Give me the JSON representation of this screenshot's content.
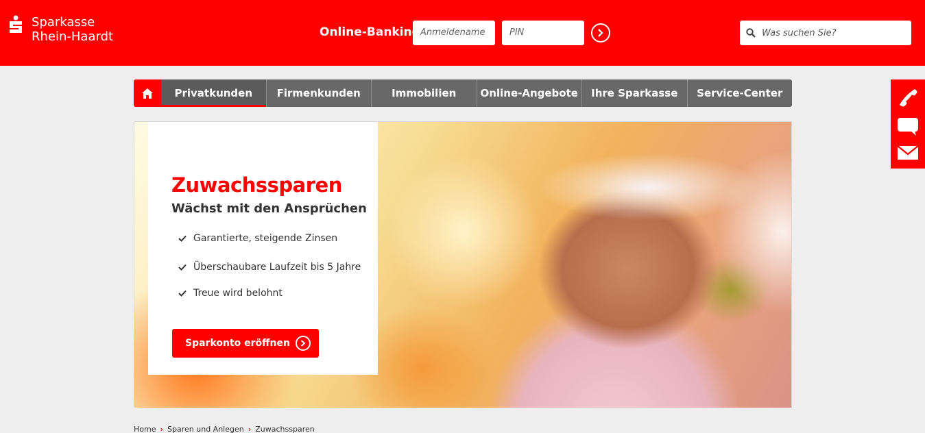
{
  "brand": {
    "line1": "Sparkasse",
    "line2": "Rhein-Haardt",
    "color": "#ff0000"
  },
  "login": {
    "label": "Online-Banking",
    "user_placeholder": "Anmeldename",
    "pin_placeholder": "PIN"
  },
  "search": {
    "placeholder": "Was suchen Sie?"
  },
  "nav": {
    "items": [
      "Privatkunden",
      "Firmenkunden",
      "Immobilien",
      "Online-Angebote",
      "Ihre Sparkasse",
      "Service-Center"
    ],
    "active": "Privatkunden"
  },
  "side_icons": [
    "phone-icon",
    "chat-icon",
    "mail-icon"
  ],
  "hero": {
    "title": "Zuwachssparen",
    "subtitle": "Wächst mit den Ansprüchen",
    "bullets": [
      "Garantierte, steigende Zinsen",
      "Überschaubare Laufzeit bis 5 Jahre",
      "Treue wird belohnt"
    ],
    "cta": "Sparkonto eröffnen"
  },
  "breadcrumb": [
    "Home",
    "Sparen und Anlegen",
    "Zuwachssparen"
  ]
}
